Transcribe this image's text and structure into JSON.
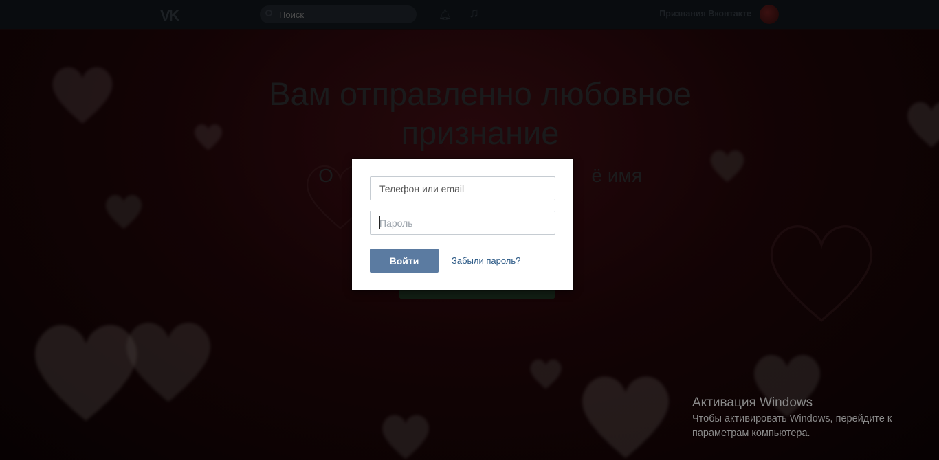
{
  "header": {
    "logo": "VK",
    "search_placeholder": "Поиск",
    "user_name": "Признания Вконтакте"
  },
  "main": {
    "headline": "Вам отправленно любовное признание",
    "subline_left": "О",
    "subline_right": "ё имя"
  },
  "login_modal": {
    "login_placeholder": "Телефон или email",
    "password_placeholder": "Пароль",
    "login_button": "Войти",
    "forgot_link": "Забыли пароль?"
  },
  "windows_watermark": {
    "title": "Активация Windows",
    "text": "Чтобы активировать Windows, перейдите к параметрам компьютера."
  },
  "colors": {
    "login_button": "#5b7ba1",
    "link": "#2a5885",
    "topbar": "#0e1318"
  },
  "icons": {
    "search": "search-icon",
    "notifications": "bell-icon",
    "music": "music-icon"
  }
}
